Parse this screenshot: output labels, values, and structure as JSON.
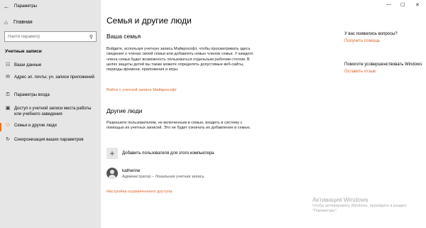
{
  "window": {
    "title": "Параметры",
    "minimize": "—",
    "maximize": "☐",
    "close": "✕"
  },
  "sidebar": {
    "home_label": "Главная",
    "search_placeholder": "Найти параметр",
    "section_title": "Учетные записи",
    "items": [
      {
        "icon": "person-card-icon",
        "glyph": "☷",
        "label": "Ваши данные"
      },
      {
        "icon": "email-icon",
        "glyph": "✉",
        "label": "Адрес эл. почты; уч. записи приложений"
      },
      {
        "icon": "key-icon",
        "glyph": "⚿",
        "label": "Параметры входа"
      },
      {
        "icon": "briefcase-icon",
        "glyph": "▣",
        "label": "Доступ к учетной записи места работы или учебного заведения"
      },
      {
        "icon": "family-icon",
        "glyph": "⚇",
        "label": "Семья и другие люди",
        "active": true
      },
      {
        "icon": "sync-icon",
        "glyph": "↻",
        "label": "Синхронизация ваших параметров"
      }
    ]
  },
  "main": {
    "page_title": "Семья и другие люди",
    "family": {
      "heading": "Ваша семья",
      "text": "Войдите, используя учетную запись Майкрософт, чтобы просматривать здесь сведения о членах своей семьи или добавлять новых членов семьи. У каждого члена семьи будет возможность пользоваться отдельным рабочим столом. В целях защиты детей вы также можете определять допустимые веб-сайты, периоды времени, приложения и игры.",
      "link": "Войти с учетной записи Майкрософт"
    },
    "others": {
      "heading": "Другие люди",
      "text": "Разрешите пользователям, не включенным в семью, входить в систему с помощью их учетных записей. Это не будет означать их добавление в семью.",
      "add_label": "Добавить пользователя для этого компьютера",
      "user_name": "katherine",
      "user_sub": "Администратор – Локальная учетная запись",
      "kiosk_link": "Настройка ограниченного доступа"
    }
  },
  "right": {
    "questions": "У вас появились вопросы?",
    "help_link": "Получить помощь",
    "improve": "Помогите усовершенствовать Windows",
    "feedback_link": "Оставить отзыв"
  },
  "watermark": {
    "title": "Активация Windows",
    "sub": "Чтобы активировать Windows, перейдите в раздел \"Параметры\"."
  }
}
